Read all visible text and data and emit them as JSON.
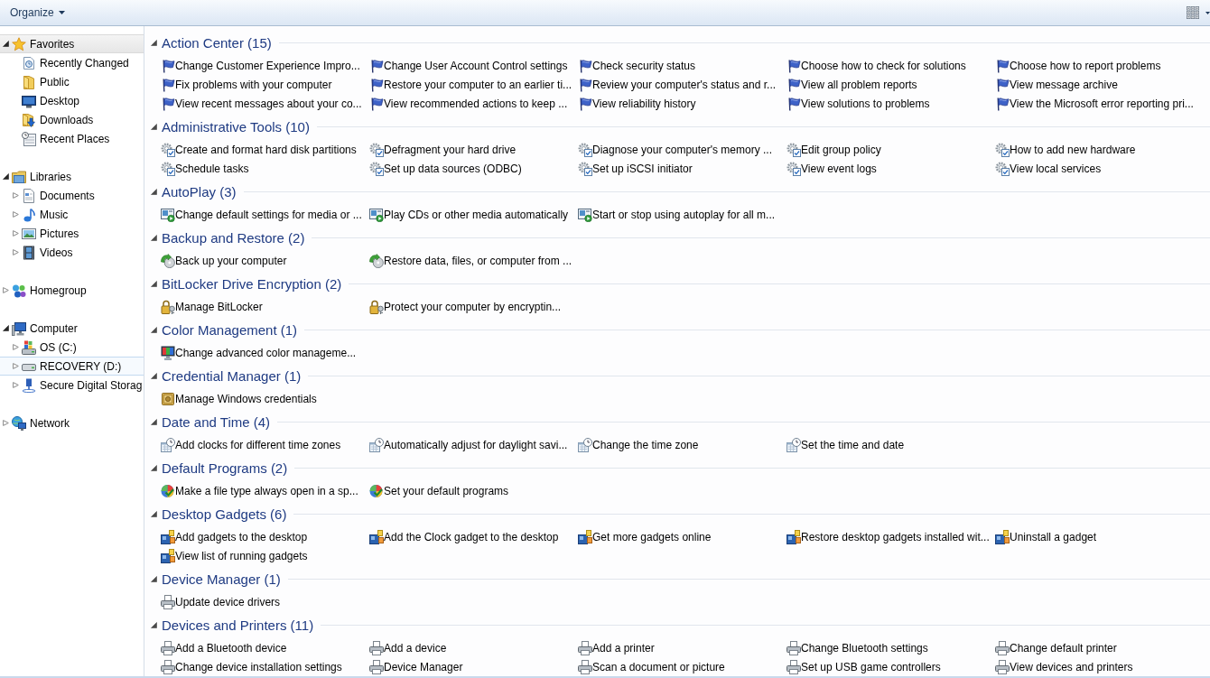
{
  "toolbar": {
    "organize_button": "Organize"
  },
  "navigation": [
    {
      "label": "Favorites",
      "expanded": true,
      "selected": true,
      "hovered": false,
      "children": [
        {
          "label": "Recently Changed",
          "selected": false,
          "hovered": false
        },
        {
          "label": "Public",
          "selected": false,
          "hovered": false
        },
        {
          "label": "Desktop",
          "selected": false,
          "hovered": false
        },
        {
          "label": "Downloads",
          "selected": false,
          "hovered": false
        },
        {
          "label": "Recent Places",
          "selected": false,
          "hovered": false
        }
      ]
    },
    {
      "label": "Libraries",
      "expanded": true,
      "selected": false,
      "hovered": false,
      "children": [
        {
          "label": "Documents",
          "expanded": false,
          "selected": false,
          "hovered": false
        },
        {
          "label": "Music",
          "expanded": false,
          "selected": false,
          "hovered": false
        },
        {
          "label": "Pictures",
          "expanded": false,
          "selected": false,
          "hovered": false
        },
        {
          "label": "Videos",
          "expanded": false,
          "selected": false,
          "hovered": false
        }
      ]
    },
    {
      "label": "Homegroup",
      "expanded": false,
      "selected": false,
      "hovered": false
    },
    {
      "label": "Computer",
      "expanded": true,
      "selected": false,
      "hovered": false,
      "children": [
        {
          "label": "OS (C:)",
          "expanded": false,
          "selected": false,
          "hovered": false
        },
        {
          "label": "RECOVERY (D:)",
          "expanded": false,
          "selected": false,
          "hovered": true
        },
        {
          "label": "Secure Digital Storag",
          "expanded": false,
          "selected": false,
          "hovered": false
        }
      ]
    },
    {
      "label": "Network",
      "expanded": false,
      "selected": false,
      "hovered": false
    }
  ],
  "sections": [
    {
      "title": "Action Center (15)",
      "expanded": true,
      "tasks": [
        "Change Customer Experience Impro...",
        "Change User Account Control settings",
        "Check security status",
        "Choose how to check for solutions",
        "Choose how to report problems",
        "Fix problems with your computer",
        "Restore your computer to an earlier ti...",
        "Review your computer's status and r...",
        "View all problem reports",
        "View message archive",
        "View recent messages about your co...",
        "View recommended actions to keep ...",
        "View reliability history",
        "View solutions to problems",
        "View the Microsoft error reporting pri..."
      ]
    },
    {
      "title": "Administrative Tools (10)",
      "expanded": true,
      "tasks": [
        "Create and format hard disk partitions",
        "Defragment your hard drive",
        "Diagnose your computer's memory ...",
        "Edit group policy",
        "How to add new hardware",
        "Schedule tasks",
        "Set up data sources (ODBC)",
        "Set up iSCSI initiator",
        "View event logs",
        "View local services"
      ]
    },
    {
      "title": "AutoPlay (3)",
      "expanded": true,
      "tasks": [
        "Change default settings for media or ...",
        "Play CDs or other media automatically",
        "Start or stop using autoplay for all m..."
      ]
    },
    {
      "title": "Backup and Restore (2)",
      "expanded": true,
      "tasks": [
        "Back up your computer",
        "Restore data, files, or computer from ..."
      ]
    },
    {
      "title": "BitLocker Drive Encryption (2)",
      "expanded": true,
      "tasks": [
        "Manage BitLocker",
        "Protect your computer by encryptin..."
      ]
    },
    {
      "title": "Color Management (1)",
      "expanded": true,
      "tasks": [
        "Change advanced color manageme..."
      ]
    },
    {
      "title": "Credential Manager (1)",
      "expanded": true,
      "tasks": [
        "Manage Windows credentials"
      ]
    },
    {
      "title": "Date and Time (4)",
      "expanded": true,
      "tasks": [
        "Add clocks for different time zones",
        "Automatically adjust for daylight savi...",
        "Change the time zone",
        "Set the time and date"
      ]
    },
    {
      "title": "Default Programs (2)",
      "expanded": true,
      "tasks": [
        "Make a file type always open in a sp...",
        "Set your default programs"
      ]
    },
    {
      "title": "Desktop Gadgets (6)",
      "expanded": true,
      "tasks": [
        "Add gadgets to the desktop",
        "Add the Clock gadget to the desktop",
        "Get more gadgets online",
        "Restore desktop gadgets installed wit...",
        "Uninstall a gadget",
        "View list of running gadgets"
      ]
    },
    {
      "title": "Device Manager (1)",
      "expanded": true,
      "tasks": [
        "Update device drivers"
      ]
    },
    {
      "title": "Devices and Printers (11)",
      "expanded": true,
      "tasks": [
        "Add a Bluetooth device",
        "Add a device",
        "Add a printer",
        "Change Bluetooth settings",
        "Change default printer",
        "Change device installation settings",
        "Device Manager",
        "Scan a document or picture",
        "Set up USB game controllers",
        "View devices and printers"
      ]
    }
  ]
}
